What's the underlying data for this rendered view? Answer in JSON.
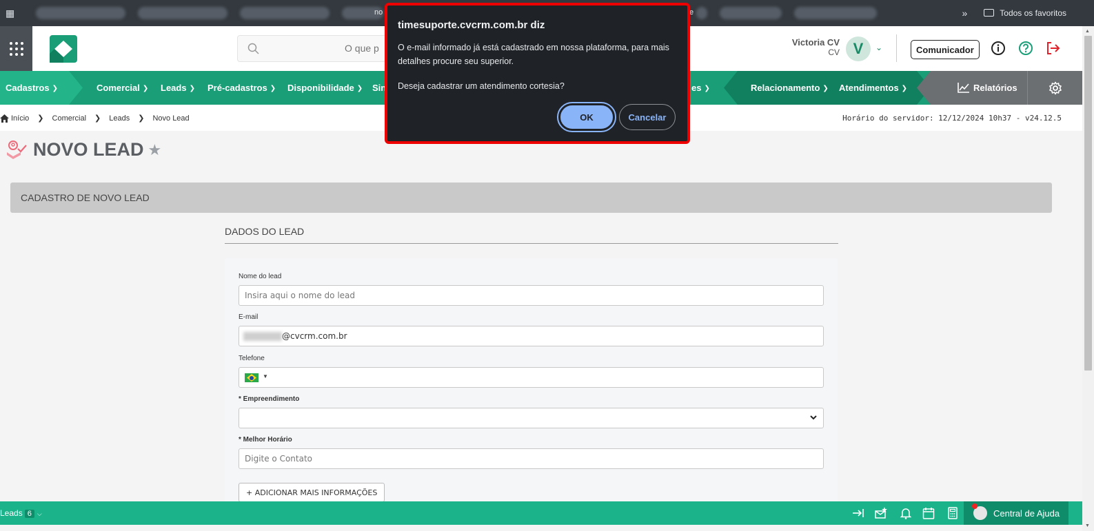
{
  "browser": {
    "favorites_label": "Todos os favoritos",
    "peek_left": "no",
    "peek_right": "e"
  },
  "header": {
    "search_placeholder": "O que p",
    "user_name": "Victoria CV",
    "user_org": "CV",
    "avatar_letter": "V",
    "comunicador": "Comunicador"
  },
  "menu": {
    "items": [
      {
        "label": "Cadastros"
      },
      {
        "label": "Comercial"
      },
      {
        "label": "Leads"
      },
      {
        "label": "Pré-cadastros"
      },
      {
        "label": "Disponibilidade"
      },
      {
        "label": "Sin"
      },
      {
        "label": "es"
      },
      {
        "label": "Relacionamento"
      },
      {
        "label": "Atendimentos"
      },
      {
        "label": "Relatórios"
      }
    ]
  },
  "breadcrumb": {
    "items": [
      "Início",
      "Comercial",
      "Leads",
      "Novo Lead"
    ],
    "server_time": "Horário do servidor: 12/12/2024 10h37 - v24.12.5"
  },
  "page": {
    "title": "NOVO LEAD",
    "panel_title": "CADASTRO DE NOVO LEAD",
    "section_title": "DADOS DO LEAD"
  },
  "form": {
    "nome_label": "Nome do lead",
    "nome_placeholder": "Insira aqui o nome do lead",
    "email_label": "E-mail",
    "email_domain": "@cvcrm.com.br",
    "telefone_label": "Telefone",
    "empreendimento_label": "* Empreendimento",
    "horario_label": "* Melhor Horário",
    "horario_placeholder": "Digite o Contato",
    "add_more": "+ ADICIONAR MAIS INFORMAÇÕES"
  },
  "footer": {
    "leads_label": "Leads",
    "leads_count": "6",
    "help_label": "Central de Ajuda"
  },
  "dialog": {
    "title": "timesuporte.cvcrm.com.br diz",
    "message": "O e-mail informado já está cadastrado em nossa plataforma, para mais detalhes procure seu superior.",
    "question": "Deseja cadastrar um atendimento cortesia?",
    "ok": "OK",
    "cancel": "Cancelar"
  },
  "colors": {
    "menu_green": "#1a9e78",
    "menu_light": "#23b589",
    "footer_green": "#1ab38a",
    "dialog_bg": "#1f2226",
    "dialog_border": "#ee0000",
    "ok_blue": "#8ab4f8"
  }
}
